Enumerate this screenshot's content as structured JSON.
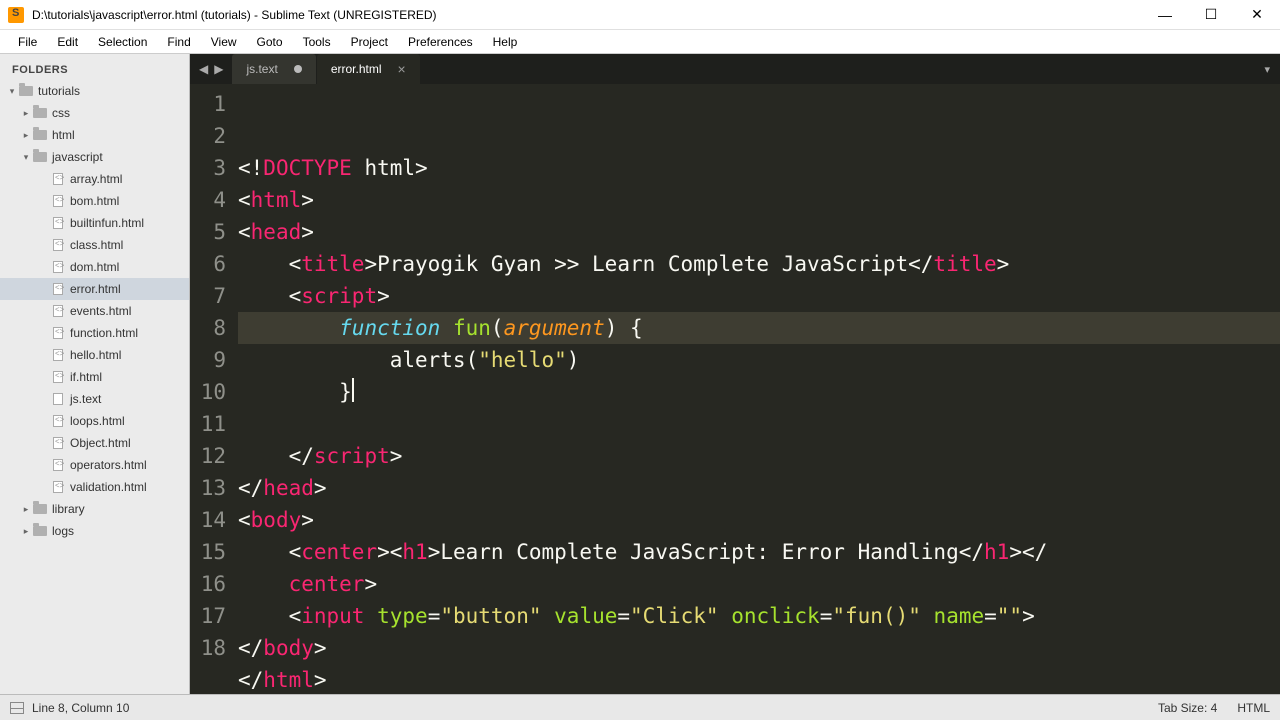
{
  "window": {
    "title": "D:\\tutorials\\javascript\\error.html (tutorials) - Sublime Text (UNREGISTERED)"
  },
  "menu": [
    "File",
    "Edit",
    "Selection",
    "Find",
    "View",
    "Goto",
    "Tools",
    "Project",
    "Preferences",
    "Help"
  ],
  "sidebar": {
    "header": "FOLDERS",
    "root": {
      "name": "tutorials",
      "expanded": true
    },
    "folders": [
      {
        "name": "css",
        "indent": 2,
        "expanded": false
      },
      {
        "name": "html",
        "indent": 2,
        "expanded": false
      }
    ],
    "js_folder": {
      "name": "javascript",
      "indent": 2,
      "expanded": true
    },
    "js_files": [
      {
        "name": "array.html",
        "type": "code"
      },
      {
        "name": "bom.html",
        "type": "code"
      },
      {
        "name": "builtinfun.html",
        "type": "code"
      },
      {
        "name": "class.html",
        "type": "code"
      },
      {
        "name": "dom.html",
        "type": "code"
      },
      {
        "name": "error.html",
        "type": "code",
        "selected": true
      },
      {
        "name": "events.html",
        "type": "code"
      },
      {
        "name": "function.html",
        "type": "code"
      },
      {
        "name": "hello.html",
        "type": "code"
      },
      {
        "name": "if.html",
        "type": "code"
      },
      {
        "name": "js.text",
        "type": "file"
      },
      {
        "name": "loops.html",
        "type": "code"
      },
      {
        "name": "Object.html",
        "type": "code"
      },
      {
        "name": "operators.html",
        "type": "code"
      },
      {
        "name": "validation.html",
        "type": "code"
      }
    ],
    "other_folders": [
      {
        "name": "library",
        "indent": 2
      },
      {
        "name": "logs",
        "indent": 2
      }
    ]
  },
  "tabs": [
    {
      "label": "js.text",
      "dirty": true,
      "active": false
    },
    {
      "label": "error.html",
      "dirty": false,
      "active": true
    }
  ],
  "code": {
    "page_title": "Prayogik Gyan >> Learn Complete JavaScript",
    "fn_keyword": "function",
    "fn_name": "fun",
    "fn_param": "argument",
    "alert_call": "alerts",
    "alert_arg": "\"hello\"",
    "h1_text": "Learn Complete JavaScript: Error Handling",
    "input_type": "\"button\"",
    "input_value": "\"Click\"",
    "input_onclick": "\"fun()\"",
    "input_name": "\"\""
  },
  "status": {
    "pos": "Line 8, Column 10",
    "tabsize": "Tab Size: 4",
    "syntax": "HTML"
  }
}
